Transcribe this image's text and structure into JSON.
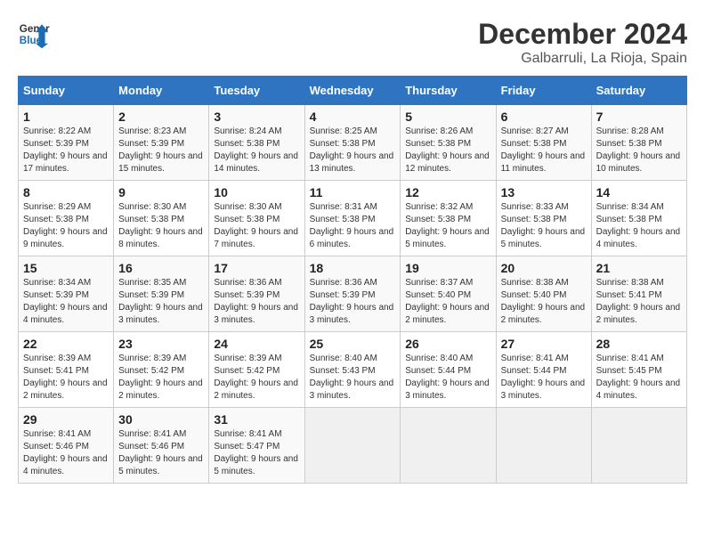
{
  "header": {
    "logo_line1": "General",
    "logo_line2": "Blue",
    "month_year": "December 2024",
    "location": "Galbarruli, La Rioja, Spain"
  },
  "calendar": {
    "weekdays": [
      "Sunday",
      "Monday",
      "Tuesday",
      "Wednesday",
      "Thursday",
      "Friday",
      "Saturday"
    ],
    "weeks": [
      [
        null,
        {
          "day": "2",
          "sunrise": "8:23 AM",
          "sunset": "5:39 PM",
          "daylight": "9 hours and 15 minutes."
        },
        {
          "day": "3",
          "sunrise": "8:24 AM",
          "sunset": "5:38 PM",
          "daylight": "9 hours and 14 minutes."
        },
        {
          "day": "4",
          "sunrise": "8:25 AM",
          "sunset": "5:38 PM",
          "daylight": "9 hours and 13 minutes."
        },
        {
          "day": "5",
          "sunrise": "8:26 AM",
          "sunset": "5:38 PM",
          "daylight": "9 hours and 12 minutes."
        },
        {
          "day": "6",
          "sunrise": "8:27 AM",
          "sunset": "5:38 PM",
          "daylight": "9 hours and 11 minutes."
        },
        {
          "day": "7",
          "sunrise": "8:28 AM",
          "sunset": "5:38 PM",
          "daylight": "9 hours and 10 minutes."
        }
      ],
      [
        {
          "day": "1",
          "sunrise": "8:22 AM",
          "sunset": "5:39 PM",
          "daylight": "9 hours and 17 minutes."
        },
        {
          "day": "9",
          "sunrise": "8:30 AM",
          "sunset": "5:38 PM",
          "daylight": "9 hours and 8 minutes."
        },
        {
          "day": "10",
          "sunrise": "8:30 AM",
          "sunset": "5:38 PM",
          "daylight": "9 hours and 7 minutes."
        },
        {
          "day": "11",
          "sunrise": "8:31 AM",
          "sunset": "5:38 PM",
          "daylight": "9 hours and 6 minutes."
        },
        {
          "day": "12",
          "sunrise": "8:32 AM",
          "sunset": "5:38 PM",
          "daylight": "9 hours and 5 minutes."
        },
        {
          "day": "13",
          "sunrise": "8:33 AM",
          "sunset": "5:38 PM",
          "daylight": "9 hours and 5 minutes."
        },
        {
          "day": "14",
          "sunrise": "8:34 AM",
          "sunset": "5:38 PM",
          "daylight": "9 hours and 4 minutes."
        }
      ],
      [
        {
          "day": "8",
          "sunrise": "8:29 AM",
          "sunset": "5:38 PM",
          "daylight": "9 hours and 9 minutes."
        },
        {
          "day": "16",
          "sunrise": "8:35 AM",
          "sunset": "5:39 PM",
          "daylight": "9 hours and 3 minutes."
        },
        {
          "day": "17",
          "sunrise": "8:36 AM",
          "sunset": "5:39 PM",
          "daylight": "9 hours and 3 minutes."
        },
        {
          "day": "18",
          "sunrise": "8:36 AM",
          "sunset": "5:39 PM",
          "daylight": "9 hours and 3 minutes."
        },
        {
          "day": "19",
          "sunrise": "8:37 AM",
          "sunset": "5:40 PM",
          "daylight": "9 hours and 2 minutes."
        },
        {
          "day": "20",
          "sunrise": "8:38 AM",
          "sunset": "5:40 PM",
          "daylight": "9 hours and 2 minutes."
        },
        {
          "day": "21",
          "sunrise": "8:38 AM",
          "sunset": "5:41 PM",
          "daylight": "9 hours and 2 minutes."
        }
      ],
      [
        {
          "day": "15",
          "sunrise": "8:34 AM",
          "sunset": "5:39 PM",
          "daylight": "9 hours and 4 minutes."
        },
        {
          "day": "23",
          "sunrise": "8:39 AM",
          "sunset": "5:42 PM",
          "daylight": "9 hours and 2 minutes."
        },
        {
          "day": "24",
          "sunrise": "8:39 AM",
          "sunset": "5:42 PM",
          "daylight": "9 hours and 2 minutes."
        },
        {
          "day": "25",
          "sunrise": "8:40 AM",
          "sunset": "5:43 PM",
          "daylight": "9 hours and 3 minutes."
        },
        {
          "day": "26",
          "sunrise": "8:40 AM",
          "sunset": "5:44 PM",
          "daylight": "9 hours and 3 minutes."
        },
        {
          "day": "27",
          "sunrise": "8:41 AM",
          "sunset": "5:44 PM",
          "daylight": "9 hours and 3 minutes."
        },
        {
          "day": "28",
          "sunrise": "8:41 AM",
          "sunset": "5:45 PM",
          "daylight": "9 hours and 4 minutes."
        }
      ],
      [
        {
          "day": "22",
          "sunrise": "8:39 AM",
          "sunset": "5:41 PM",
          "daylight": "9 hours and 2 minutes."
        },
        {
          "day": "30",
          "sunrise": "8:41 AM",
          "sunset": "5:46 PM",
          "daylight": "9 hours and 5 minutes."
        },
        {
          "day": "31",
          "sunrise": "8:41 AM",
          "sunset": "5:47 PM",
          "daylight": "9 hours and 5 minutes."
        },
        null,
        null,
        null,
        null
      ],
      [
        {
          "day": "29",
          "sunrise": "8:41 AM",
          "sunset": "5:46 PM",
          "daylight": "9 hours and 4 minutes."
        },
        null,
        null,
        null,
        null,
        null,
        null
      ]
    ]
  }
}
